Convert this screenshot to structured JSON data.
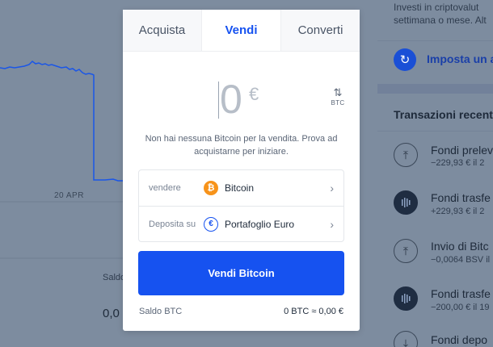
{
  "modal": {
    "tabs": [
      {
        "label": "Acquista"
      },
      {
        "label": "Vendi"
      },
      {
        "label": "Converti"
      }
    ],
    "active_tab": "Vendi",
    "amount": {
      "value": "0",
      "currency_symbol": "€",
      "swap_icon": "swap-vertical-icon",
      "swap_currency": "BTC"
    },
    "notice": "Non hai nessuna Bitcoin per la vendita. Prova ad acquistarne per iniziare.",
    "sell_row": {
      "label": "vendere",
      "value": "Bitcoin",
      "icon": "bitcoin-icon",
      "icon_glyph": "₿"
    },
    "deposit_row": {
      "label": "Deposita su",
      "value": "Portafoglio Euro",
      "icon": "euro-wallet-icon",
      "icon_glyph": "€"
    },
    "primary_button": "Vendi Bitcoin",
    "footer": {
      "label": "Saldo BTC",
      "balance": "0 BTC  ≈ 0,00 €"
    },
    "accent_color": "#1652f0"
  },
  "background": {
    "chart_date": "20 APR",
    "left_saldo_label": "Saldo",
    "left_value": "0,0",
    "right_intro_line1": "Investi in criptovalut",
    "right_intro_line2": "settimana o mese. Alt",
    "recurring_link": "Imposta un a",
    "transactions_title": "Transazioni recent",
    "transactions": [
      {
        "title": "Fondi prelev",
        "sub": "−229,93 € il 2",
        "icon": "upload-icon"
      },
      {
        "title": "Fondi trasfe",
        "sub": "+229,93 € il 2",
        "icon": "bars-icon"
      },
      {
        "title": "Invio di Bitc",
        "sub": "−0,0064 BSV il",
        "icon": "upload-icon"
      },
      {
        "title": "Fondi trasfe",
        "sub": "−200,00 € il 19",
        "icon": "bars-icon"
      },
      {
        "title": "Fondi depo",
        "sub": "",
        "icon": "download-icon"
      }
    ]
  }
}
